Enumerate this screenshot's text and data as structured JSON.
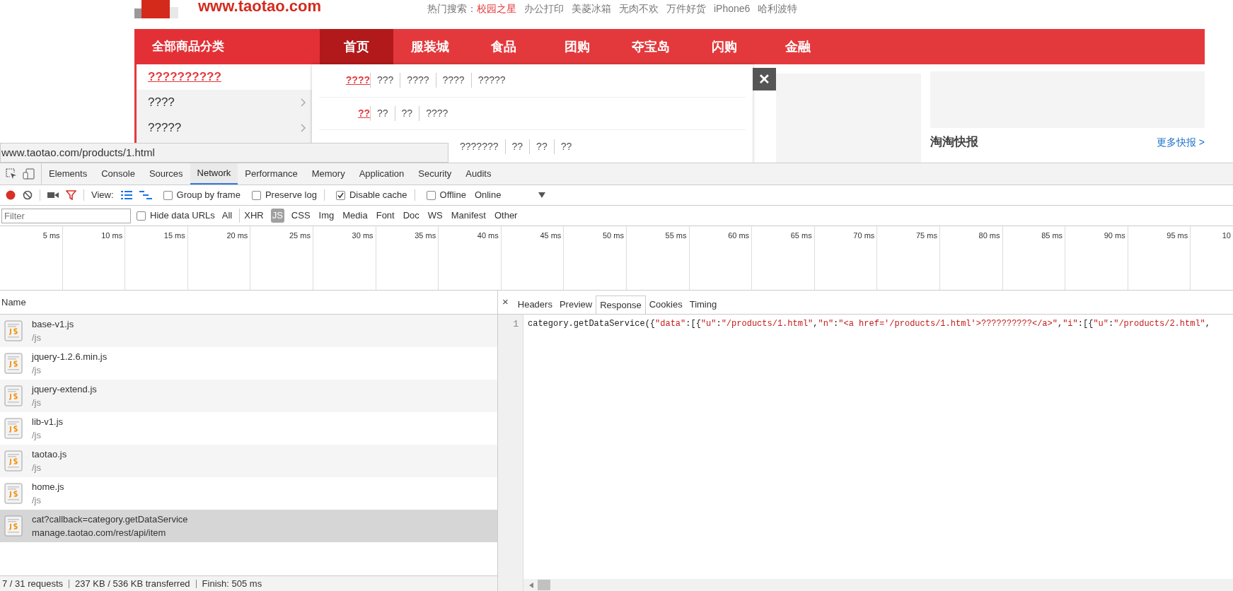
{
  "site": {
    "logo_text": "www.taotao.com",
    "hot_search_label": "热门搜索：",
    "hot_search": [
      {
        "text": "校园之星",
        "highlighted": true
      },
      {
        "text": "办公打印",
        "highlighted": false
      },
      {
        "text": "美菱冰箱",
        "highlighted": false
      },
      {
        "text": "无肉不欢",
        "highlighted": false
      },
      {
        "text": "万件好货",
        "highlighted": false
      },
      {
        "text": "iPhone6",
        "highlighted": false
      },
      {
        "text": "哈利波特",
        "highlighted": false
      }
    ],
    "category_button": "全部商品分类",
    "nav": [
      {
        "label": "首页",
        "selected": true
      },
      {
        "label": "服装城",
        "selected": false
      },
      {
        "label": "食品",
        "selected": false
      },
      {
        "label": "团购",
        "selected": false
      },
      {
        "label": "夺宝岛",
        "selected": false
      },
      {
        "label": "闪购",
        "selected": false
      },
      {
        "label": "金融",
        "selected": false
      }
    ],
    "categories": [
      {
        "label": "??????????",
        "selected": true
      },
      {
        "label": "????",
        "selected": false
      },
      {
        "label": "?????",
        "selected": false
      }
    ],
    "popup_rows": [
      {
        "lead": "????",
        "links": [
          "???",
          "????",
          "????",
          "?????"
        ]
      },
      {
        "lead": "??",
        "links": [
          "??",
          "??",
          "????"
        ]
      },
      {
        "links": [
          "???????",
          "??",
          "??",
          "??"
        ]
      }
    ],
    "close": "✕",
    "news": {
      "title": "淘淘快报",
      "more": "更多快报 >"
    },
    "status_url": "www.taotao.com/products/1.html"
  },
  "devtools": {
    "tabs": [
      {
        "label": "Elements",
        "selected": false
      },
      {
        "label": "Console",
        "selected": false
      },
      {
        "label": "Sources",
        "selected": false
      },
      {
        "label": "Network",
        "selected": true
      },
      {
        "label": "Performance",
        "selected": false
      },
      {
        "label": "Memory",
        "selected": false
      },
      {
        "label": "Application",
        "selected": false
      },
      {
        "label": "Security",
        "selected": false
      },
      {
        "label": "Audits",
        "selected": false
      }
    ],
    "view_label": "View:",
    "options": [
      {
        "label": "Group by frame",
        "checked": false
      },
      {
        "label": "Preserve log",
        "checked": false
      },
      {
        "label": "Disable cache",
        "checked": true
      },
      {
        "label": "Offline",
        "checked": false
      }
    ],
    "throttling": "Online",
    "filter": {
      "placeholder": "Filter"
    },
    "hide_data_urls": {
      "label": "Hide data URLs",
      "checked": false
    },
    "types": [
      {
        "label": "All",
        "selected": false
      },
      {
        "label": "XHR",
        "selected": false
      },
      {
        "label": "JS",
        "selected": true
      },
      {
        "label": "CSS",
        "selected": false
      },
      {
        "label": "Img",
        "selected": false
      },
      {
        "label": "Media",
        "selected": false
      },
      {
        "label": "Font",
        "selected": false
      },
      {
        "label": "Doc",
        "selected": false
      },
      {
        "label": "WS",
        "selected": false
      },
      {
        "label": "Manifest",
        "selected": false
      },
      {
        "label": "Other",
        "selected": false
      }
    ],
    "timeline_ticks": [
      "5 ms",
      "10 ms",
      "15 ms",
      "20 ms",
      "25 ms",
      "30 ms",
      "35 ms",
      "40 ms",
      "45 ms",
      "50 ms",
      "55 ms",
      "60 ms",
      "65 ms",
      "70 ms",
      "75 ms",
      "80 ms",
      "85 ms",
      "90 ms",
      "95 ms",
      "10"
    ],
    "name_header": "Name",
    "requests": [
      {
        "name": "base-v1.js",
        "path": "/js",
        "selected": false
      },
      {
        "name": "jquery-1.2.6.min.js",
        "path": "/js",
        "selected": false
      },
      {
        "name": "jquery-extend.js",
        "path": "/js",
        "selected": false
      },
      {
        "name": "lib-v1.js",
        "path": "/js",
        "selected": false
      },
      {
        "name": "taotao.js",
        "path": "/js",
        "selected": false
      },
      {
        "name": "home.js",
        "path": "/js",
        "selected": false
      },
      {
        "name": "cat?callback=category.getDataService",
        "path": "manage.taotao.com/rest/api/item",
        "selected": true
      }
    ],
    "summary": [
      "7 / 31 requests",
      "237 KB / 536 KB transferred",
      "Finish: 505 ms"
    ],
    "detail_close": "×",
    "detail_tabs": [
      {
        "label": "Headers",
        "selected": false
      },
      {
        "label": "Preview",
        "selected": false
      },
      {
        "label": "Response",
        "selected": true
      },
      {
        "label": "Cookies",
        "selected": false
      },
      {
        "label": "Timing",
        "selected": false
      }
    ],
    "line_number": "1",
    "code": [
      {
        "text": "category.getDataService({",
        "kind": "punct"
      },
      {
        "text": "\"data\"",
        "kind": "string"
      },
      {
        "text": ":[{",
        "kind": "punct"
      },
      {
        "text": "\"u\"",
        "kind": "string"
      },
      {
        "text": ":",
        "kind": "punct"
      },
      {
        "text": "\"/products/1.html\"",
        "kind": "string"
      },
      {
        "text": ",",
        "kind": "punct"
      },
      {
        "text": "\"n\"",
        "kind": "string"
      },
      {
        "text": ":",
        "kind": "punct"
      },
      {
        "text": "\"<a href='/products/1.html'>??????????</a>\"",
        "kind": "string"
      },
      {
        "text": ",",
        "kind": "punct"
      },
      {
        "text": "\"i\"",
        "kind": "string"
      },
      {
        "text": ":[{",
        "kind": "punct"
      },
      {
        "text": "\"u\"",
        "kind": "string"
      },
      {
        "text": ":",
        "kind": "punct"
      },
      {
        "text": "\"/products/2.html\"",
        "kind": "string"
      },
      {
        "text": ",",
        "kind": "punct"
      }
    ]
  }
}
